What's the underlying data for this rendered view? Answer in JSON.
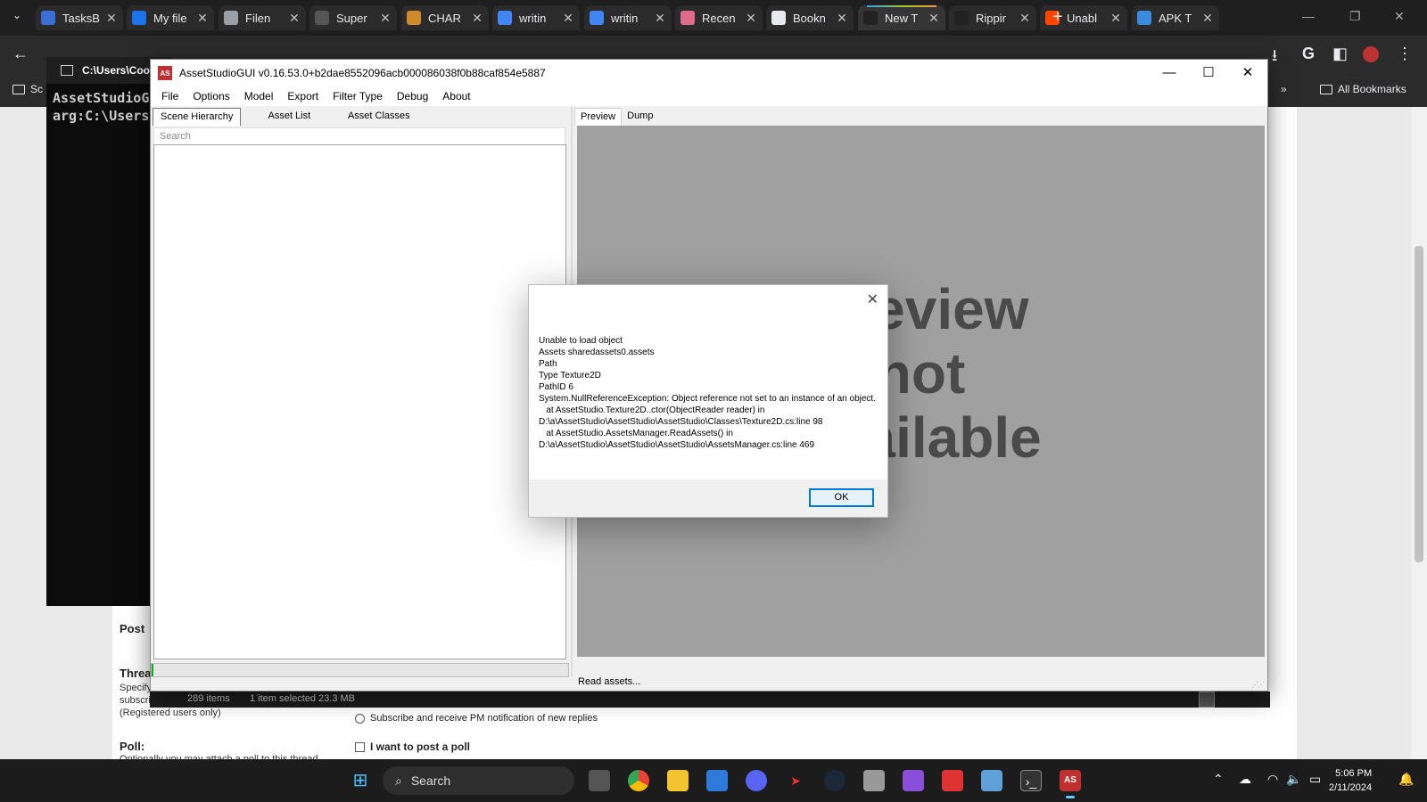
{
  "browser": {
    "tabs": [
      {
        "title": "TasksB",
        "color": "#3b6fd4"
      },
      {
        "title": "My file",
        "color": "#1a73e8"
      },
      {
        "title": "Filen",
        "color": "#9aa0a6"
      },
      {
        "title": "Super",
        "color": "#555555"
      },
      {
        "title": "CHAR",
        "color": "#d08a2b"
      },
      {
        "title": "writin",
        "color": "#4285f4"
      },
      {
        "title": "writin",
        "color": "#4285f4"
      },
      {
        "title": "Recen",
        "color": "#e06c8c"
      },
      {
        "title": "Bookn",
        "color": "#e8eaed"
      },
      {
        "title": "New T",
        "color": "#222222"
      },
      {
        "title": "Rippir",
        "color": "#222222"
      },
      {
        "title": "Unabl",
        "color": "#ff4500"
      },
      {
        "title": "APK T",
        "color": "#3a8be0"
      }
    ],
    "bookmarks": {
      "left_label": "Sc",
      "all_bookmarks": "All Bookmarks"
    }
  },
  "cmd": {
    "title": "C:\\Users\\Coo",
    "line1": "AssetStudioG",
    "line2": "arg:C:\\Users"
  },
  "forum": {
    "post_label": "Post",
    "thread_label": "Threa",
    "thread_desc1": "Specify",
    "thread_desc2": "subscription",
    "thread_desc3": "(Registered users only)",
    "subscribe_option": "Subscribe and receive PM notification of new replies",
    "poll_label": "Poll:",
    "poll_desc": "Optionally you may attach a poll to this thread",
    "poll_check": "I want to post a poll"
  },
  "explorer_status": {
    "items": "289 items",
    "selected": "1 item selected  23.3 MB"
  },
  "app": {
    "title": "AssetStudioGUI v0.16.53.0+b2dae8552096acb000086038f0b88caf854e5887",
    "logo": "AS",
    "menu": [
      "File",
      "Options",
      "Model",
      "Export",
      "Filter Type",
      "Debug",
      "About"
    ],
    "left_tabs": [
      "Scene Hierarchy",
      "Asset List",
      "Asset Classes"
    ],
    "search_placeholder": "Search",
    "progress_fraction": 0.004,
    "right_tabs": [
      "Preview",
      "Dump"
    ],
    "preview_text": "Preview\nnot\navailable",
    "status": "Read assets..."
  },
  "dialog": {
    "message": "Unable to load object\nAssets sharedassets0.assets\nPath\nType Texture2D\nPathID 6\nSystem.NullReferenceException: Object reference not set to an instance of an object.\n   at AssetStudio.Texture2D..ctor(ObjectReader reader) in D:\\a\\AssetStudio\\AssetStudio\\AssetStudio\\Classes\\Texture2D.cs:line 98\n   at AssetStudio.AssetsManager.ReadAssets() in D:\\a\\AssetStudio\\AssetStudio\\AssetStudio\\AssetsManager.cs:line 469",
    "ok_label": "OK"
  },
  "taskbar": {
    "search_label": "Search",
    "time": "5:06 PM",
    "date": "2/11/2024"
  }
}
